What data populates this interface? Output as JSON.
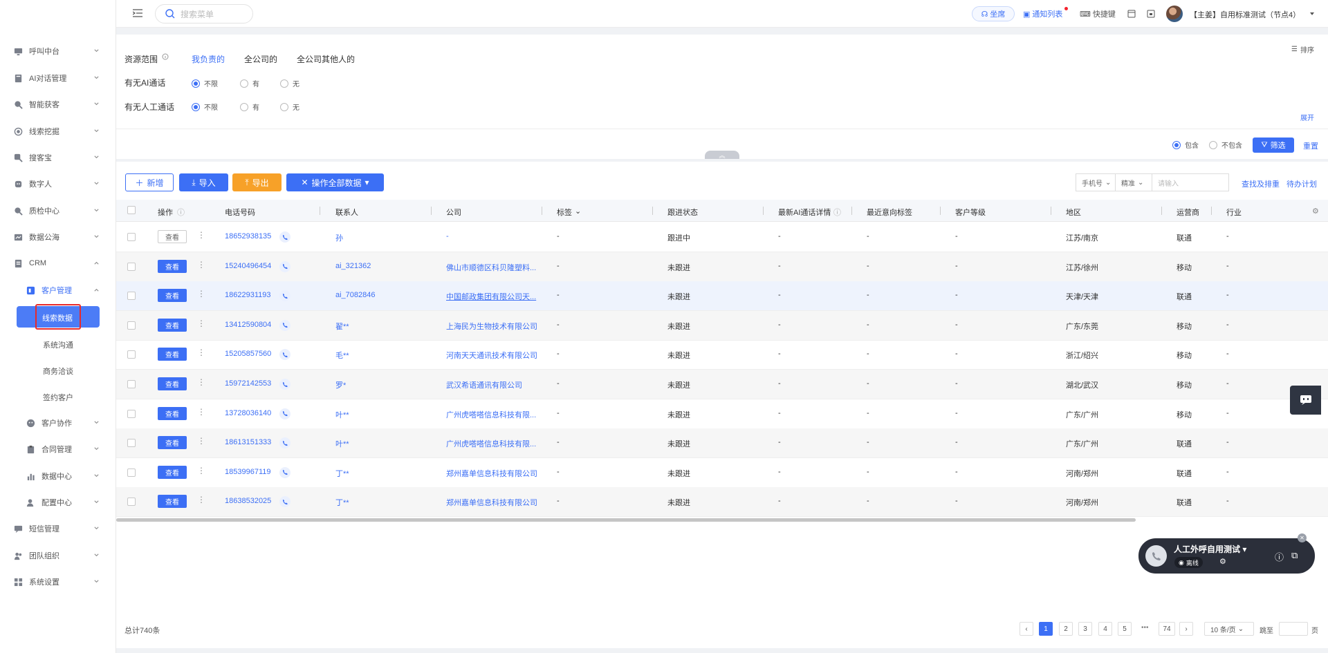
{
  "sidebar": {
    "items": [
      {
        "label": "呼叫中台",
        "icon": "monitor-icon"
      },
      {
        "label": "AI对话管理",
        "icon": "book-icon"
      },
      {
        "label": "智能获客",
        "icon": "search-people-icon"
      },
      {
        "label": "线索挖掘",
        "icon": "target-icon"
      },
      {
        "label": "搜客宝",
        "icon": "search-icon"
      },
      {
        "label": "数字人",
        "icon": "digital-person-icon"
      },
      {
        "label": "质检中心",
        "icon": "inspect-icon"
      },
      {
        "label": "数据公海",
        "icon": "chart-icon"
      },
      {
        "label": "CRM",
        "icon": "crm-icon"
      }
    ],
    "crm_sub": {
      "customer_mgmt": "客户管理",
      "leaves": [
        "线索数据",
        "系统沟通",
        "商务洽谈",
        "签约客户"
      ],
      "selected": "线索数据",
      "other_groups": [
        "客户协作",
        "合同管理",
        "数据中心",
        "配置中心"
      ]
    },
    "bottom_items": [
      {
        "label": "短信管理",
        "icon": "message-icon"
      },
      {
        "label": "团队组织",
        "icon": "team-icon"
      },
      {
        "label": "系统设置",
        "icon": "settings-icon"
      }
    ]
  },
  "header": {
    "search_placeholder": "搜索菜单",
    "seat": "坐席",
    "notice": "通知列表",
    "shortcut": "快捷键",
    "user": "【主姜】自用标准测试（节点4）"
  },
  "filter": {
    "scope_label": "资源范围",
    "scope_tabs": [
      "我负责的",
      "全公司的",
      "全公司其他人的"
    ],
    "scope_active": "我负责的",
    "ai_call_label": "有无AI通话",
    "manual_call_label": "有无人工通话",
    "options": [
      "不限",
      "有",
      "无"
    ],
    "selected_option": "不限",
    "sort": "排序",
    "expand": "展开",
    "include": "包含",
    "exclude": "不包含",
    "filter_btn": "筛选",
    "reset": "重置"
  },
  "toolbar": {
    "add": "新增",
    "import": "导入",
    "export": "导出",
    "ops": "操作全部数据",
    "field_select": "手机号",
    "match_select": "精准",
    "input_placeholder": "请输入",
    "find_dedupe": "查找及排重",
    "todo_plan": "待办计划"
  },
  "table": {
    "headers": [
      "操作",
      "电话号码",
      "联系人",
      "公司",
      "标签",
      "跟进状态",
      "最新AI通话详情",
      "最近意向标签",
      "客户等级",
      "地区",
      "运营商",
      "行业"
    ],
    "view_label": "查看",
    "rows": [
      {
        "phone": "18652938135",
        "contact": "孙",
        "company": "-",
        "tag": "-",
        "status": "跟进中",
        "ai": "-",
        "intent": "-",
        "level": "-",
        "region": "江苏/南京",
        "carrier": "联通",
        "industry": "-"
      },
      {
        "phone": "15240496454",
        "contact": "ai_321362",
        "company": "佛山市顺德区科贝隆塑料...",
        "tag": "-",
        "status": "未跟进",
        "ai": "-",
        "intent": "-",
        "level": "-",
        "region": "江苏/徐州",
        "carrier": "移动",
        "industry": "-"
      },
      {
        "phone": "18622931193",
        "contact": "ai_7082846",
        "company": "中国邮政集团有限公司天...",
        "tag": "-",
        "status": "未跟进",
        "ai": "-",
        "intent": "-",
        "level": "-",
        "region": "天津/天津",
        "carrier": "联通",
        "industry": "-"
      },
      {
        "phone": "13412590804",
        "contact": "翟**",
        "company": "上海民为生物技术有限公司",
        "tag": "-",
        "status": "未跟进",
        "ai": "-",
        "intent": "-",
        "level": "-",
        "region": "广东/东莞",
        "carrier": "移动",
        "industry": "-"
      },
      {
        "phone": "15205857560",
        "contact": "毛**",
        "company": "河南天天通讯技术有限公司",
        "tag": "-",
        "status": "未跟进",
        "ai": "-",
        "intent": "-",
        "level": "-",
        "region": "浙江/绍兴",
        "carrier": "移动",
        "industry": "-"
      },
      {
        "phone": "15972142553",
        "contact": "罗*",
        "company": "武汉希语通讯有限公司",
        "tag": "-",
        "status": "未跟进",
        "ai": "-",
        "intent": "-",
        "level": "-",
        "region": "湖北/武汉",
        "carrier": "移动",
        "industry": "-"
      },
      {
        "phone": "13728036140",
        "contact": "叶**",
        "company": "广州虎嗒嗒信息科技有限...",
        "tag": "-",
        "status": "未跟进",
        "ai": "-",
        "intent": "-",
        "level": "-",
        "region": "广东/广州",
        "carrier": "移动",
        "industry": "-"
      },
      {
        "phone": "18613151333",
        "contact": "叶**",
        "company": "广州虎嗒嗒信息科技有限...",
        "tag": "-",
        "status": "未跟进",
        "ai": "-",
        "intent": "-",
        "level": "-",
        "region": "广东/广州",
        "carrier": "联通",
        "industry": "-"
      },
      {
        "phone": "18539967119",
        "contact": "丁**",
        "company": "郑州嘉单信息科技有限公司",
        "tag": "-",
        "status": "未跟进",
        "ai": "-",
        "intent": "-",
        "level": "-",
        "region": "河南/郑州",
        "carrier": "联通",
        "industry": "-"
      },
      {
        "phone": "18638532025",
        "contact": "丁**",
        "company": "郑州嘉单信息科技有限公司",
        "tag": "-",
        "status": "未跟进",
        "ai": "-",
        "intent": "-",
        "level": "-",
        "region": "河南/郑州",
        "carrier": "联通",
        "industry": "-"
      }
    ]
  },
  "pagination": {
    "total": "总计740条",
    "pages": [
      "1",
      "2",
      "3",
      "4",
      "5"
    ],
    "current": "1",
    "last": "74",
    "page_size": "10 条/页",
    "jump_label": "跳至",
    "page_unit": "页"
  },
  "callbar": {
    "title": "人工外呼自用测试",
    "status": "离线"
  },
  "colors": {
    "primary": "#3c6ff5",
    "orange": "#f7a128",
    "highlight": "#e82a2a"
  }
}
